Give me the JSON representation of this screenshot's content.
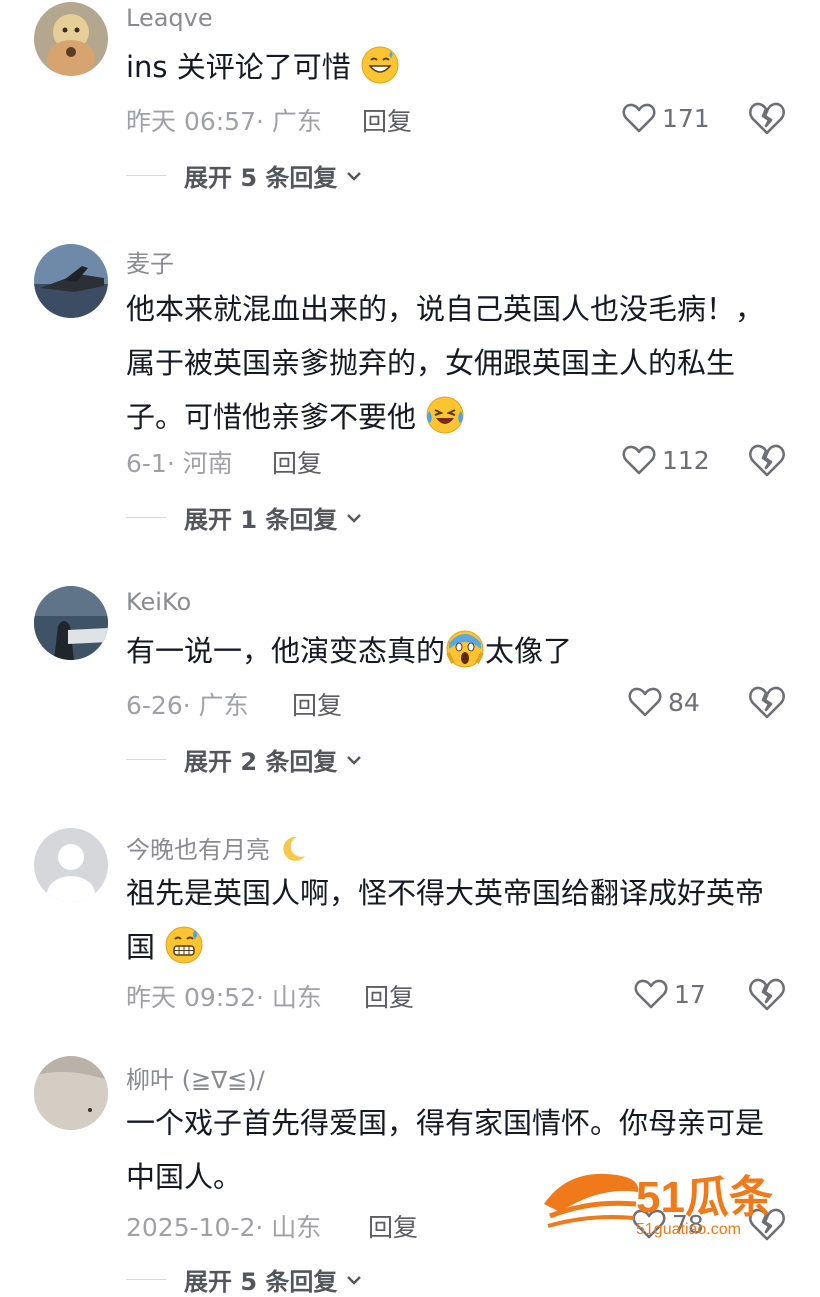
{
  "comments": [
    {
      "username": "Leaqve",
      "text": "ins 关评论了可惜",
      "emoji": "grinning-sweat-emoji",
      "meta": "昨天 06:57· 广东",
      "reply_label": "回复",
      "likes": "171",
      "expand_label": "展开 5 条回复"
    },
    {
      "username": "麦子",
      "text": "他本来就混血出来的，说自己英国人也没毛病！，属于被英国亲爹抛弃的，女佣跟英国主人的私生子。可惜他亲爹不要他",
      "emoji": "crying-laughing-emoji",
      "meta": "6-1· 河南",
      "reply_label": "回复",
      "likes": "112",
      "expand_label": "展开 1 条回复"
    },
    {
      "username": "KeiKo",
      "text_before": "有一说一，他演变态真的",
      "emoji": "screaming-face-emoji",
      "text_after": "太像了",
      "meta": "6-26· 广东",
      "reply_label": "回复",
      "likes": "84",
      "expand_label": "展开 2 条回复"
    },
    {
      "username": "今晚也有月亮",
      "username_emoji": "crescent-moon-emoji",
      "text": "祖先是英国人啊，怪不得大英帝国给翻译成好英帝国",
      "emoji": "grimacing-sweat-emoji",
      "meta": "昨天 09:52· 山东",
      "reply_label": "回复",
      "likes": "17"
    },
    {
      "username": "柳叶 (≧∇≦)/",
      "text": "一个戏子首先得爱国，得有家国情怀。你母亲可是中国人。",
      "meta": "2025-10-2· 山东",
      "reply_label": "回复",
      "likes": "78",
      "expand_label": "展开 5 条回复"
    }
  ],
  "watermark": {
    "logo_text": "51瓜条",
    "url_text": "51guatiao.com",
    "color": "#f07a1a"
  },
  "colors": {
    "text": "#161823",
    "meta": "#a0a1a6",
    "username": "#8a8b91",
    "icon": "#6e6f75"
  },
  "icons": {
    "like": "heart-outline-icon",
    "dislike": "broken-heart-icon",
    "expand": "chevron-down-icon"
  }
}
